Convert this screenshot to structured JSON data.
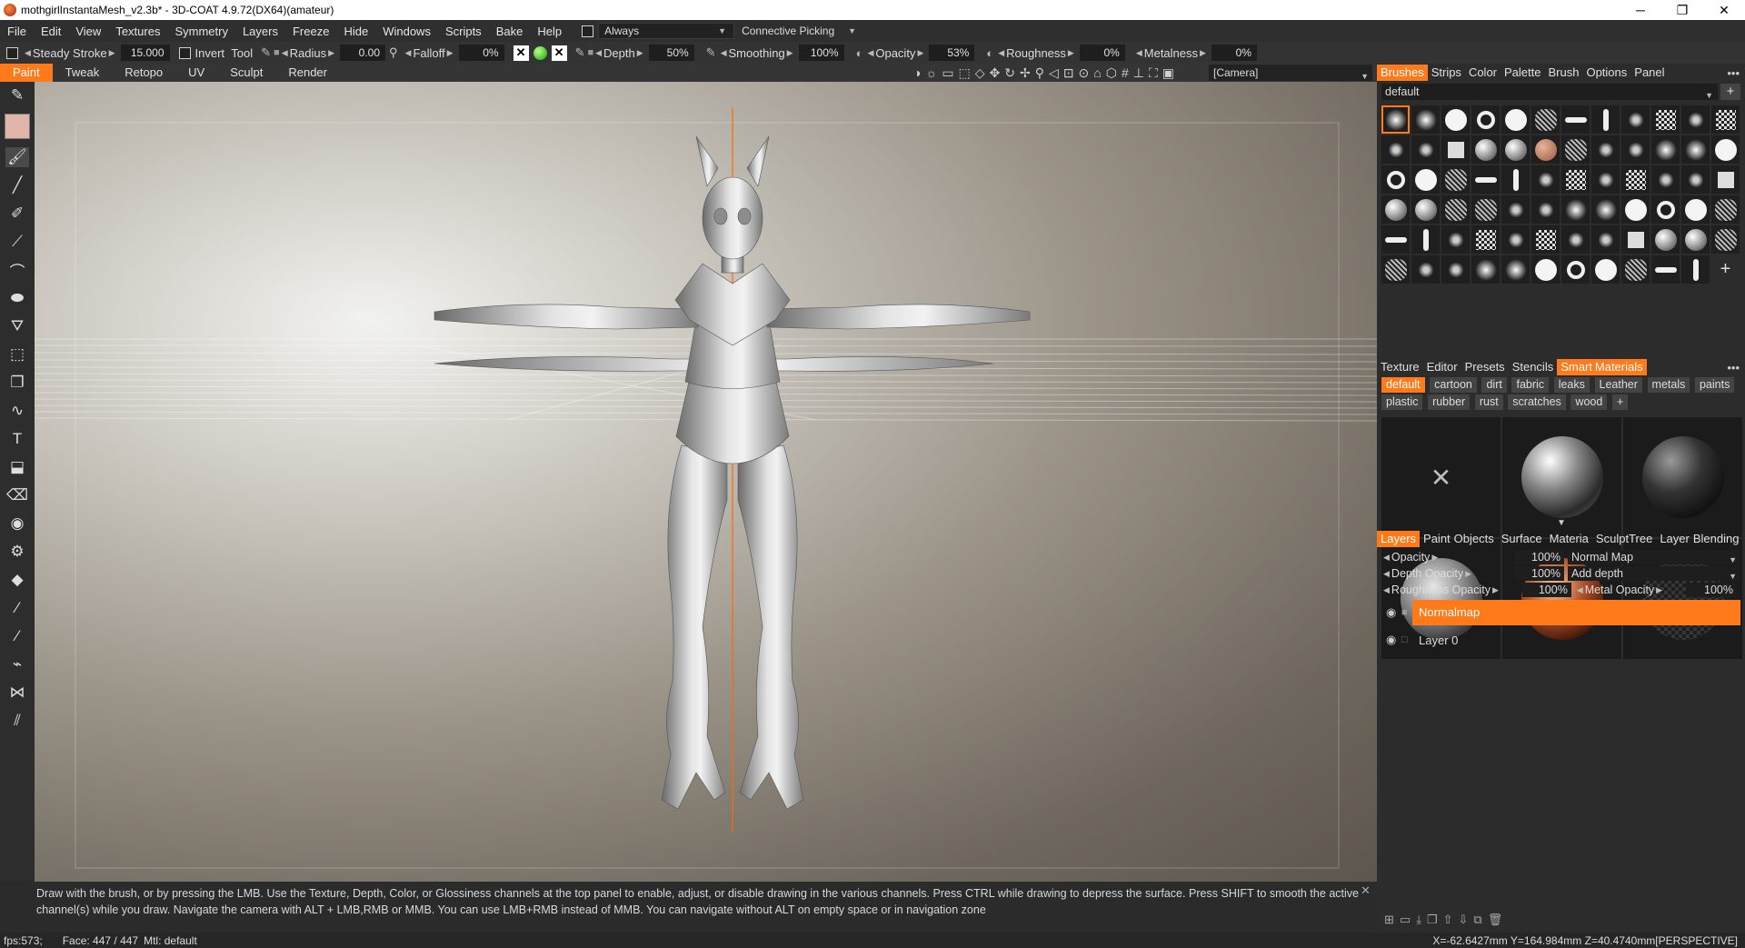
{
  "window": {
    "title": "mothgirlInstantaMesh_v2.3b* - 3D-COAT 4.9.72(DX64)(amateur)",
    "min": "─",
    "max": "❐",
    "close": "✕"
  },
  "menu": {
    "items": [
      "File",
      "Edit",
      "View",
      "Textures",
      "Symmetry",
      "Layers",
      "Freeze",
      "Hide",
      "Windows",
      "Scripts",
      "Bake",
      "Help"
    ],
    "always_label": "Always",
    "picking_label": "Connective Picking"
  },
  "brushbar": {
    "steady_label": "Steady",
    "stroke_label": "Stroke",
    "stroke_value": "15.000",
    "invert_label": "Invert",
    "tool_label": "Tool",
    "radius_label": "Radius",
    "radius_value": "0.00",
    "falloff_label": "Falloff",
    "falloff_value": "0%",
    "depth_label": "Depth",
    "depth_value": "50%",
    "smoothing_label": "Smoothing",
    "smoothing_value": "100%",
    "opacity_label": "Opacity",
    "opacity_value": "53%",
    "roughness_label": "Roughness",
    "roughness_value": "0%",
    "metalness_label": "Metalness",
    "metalness_value": "0%"
  },
  "rooms": [
    "Paint",
    "Tweak",
    "Retopo",
    "UV",
    "Sculpt",
    "Render"
  ],
  "active_room": "Paint",
  "camera_label": "[Camera]",
  "brushes_panel": {
    "tabs": [
      "Brushes",
      "Strips",
      "Color",
      "Palette",
      "Brush",
      "Options",
      "Panel"
    ],
    "preset": "default",
    "add": "+",
    "more": "•••"
  },
  "materials_panel": {
    "tabs": [
      "Texture",
      "Editor",
      "Presets",
      "Stencils",
      "Smart",
      "Materials"
    ],
    "chips": [
      "default",
      "cartoon",
      "dirt",
      "fabric",
      "leaks",
      "Leather",
      "metals",
      "paints",
      "plastic",
      "rubber",
      "rust",
      "scratches",
      "wood",
      "+"
    ],
    "active_chip": "default",
    "remove": "✕"
  },
  "layers_panel": {
    "tabs": [
      "Layers",
      "Paint",
      "Objects",
      "Surface",
      "Materia",
      "SculptTree",
      "Layer",
      "Blending"
    ],
    "opacity_label": "Opacity",
    "opacity_value": "100%",
    "blend_mode": "Normal Map",
    "depth_opacity_label": "Depth Opacity",
    "depth_opacity_value": "100%",
    "depth_mode": "Add depth",
    "roughness_opacity_label": "Roughness Opacity",
    "roughness_opacity_value": "100%",
    "metal_opacity_label": "Metal Opacity",
    "metal_opacity_value": "100%",
    "layers": [
      {
        "name": "Normalmap",
        "active": true
      },
      {
        "name": "Layer 0",
        "active": false
      }
    ]
  },
  "hint": "Draw with the brush, or by pressing the LMB. Use the Texture, Depth, Color, or Glossiness channels at the top panel to enable, adjust, or disable drawing in the various channels. Press CTRL while drawing to depress the surface. Press SHIFT to smooth the active channel(s) while you draw. Navigate the camera with ALT + LMB,RMB or MMB. You can use LMB+RMB instead of MMB. You can navigate without ALT on empty space or in navigation zone",
  "hint_close": "✕",
  "status": {
    "fps": "fps:573;",
    "face": "Face: 447 / 447",
    "mtl": "Mtl: default",
    "coords": "X=-62.6427mm  Y=164.984mm  Z=40.4740mm[PERSPECTIVE]"
  },
  "colors": {
    "accent": "#ff7a1a"
  }
}
